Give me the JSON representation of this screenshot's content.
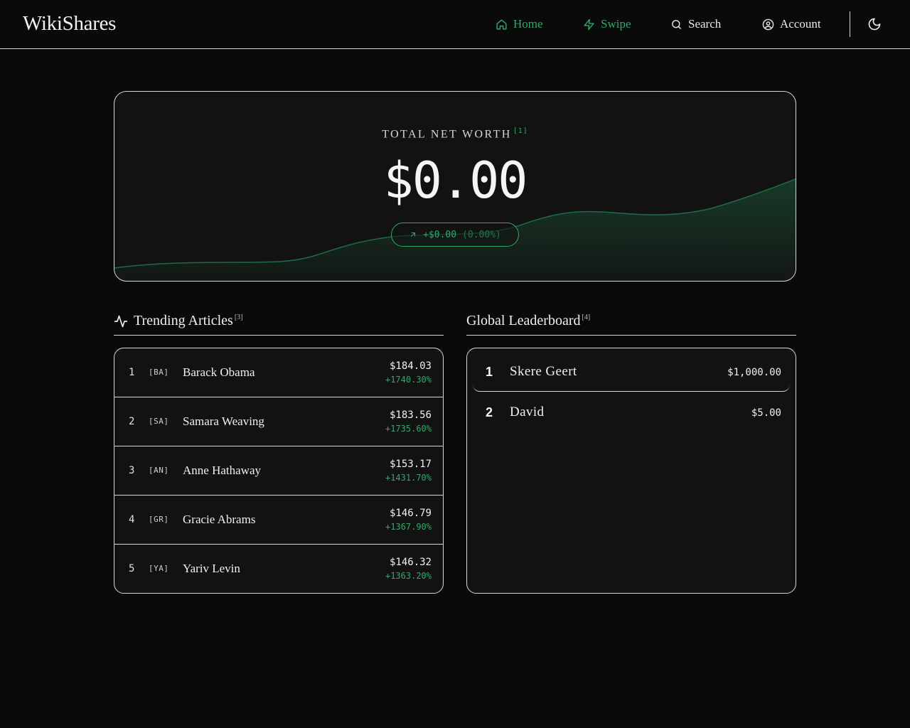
{
  "app": {
    "title": "WikiShares"
  },
  "nav": {
    "home": "Home",
    "swipe": "Swipe",
    "search": "Search",
    "account": "Account"
  },
  "colors": {
    "accent": "#2faa6a",
    "background": "#0a0a0a",
    "card": "#121212",
    "border": "#d8d8d8"
  },
  "icons": {
    "home": "home-icon",
    "swipe": "lightning-icon",
    "search": "search-icon",
    "account": "user-circle-icon",
    "theme": "moon-icon",
    "trending": "activity-icon",
    "change": "arrow-up-right-icon"
  },
  "hero": {
    "label": "TOTAL NET WORTH",
    "label_ref": "[1]",
    "value": "$0.00",
    "change": "+$0.00",
    "change_pct": "(0.00%)"
  },
  "trending": {
    "title": "Trending Articles",
    "ref": "[3]",
    "items": [
      {
        "rank": "1",
        "code": "[BA]",
        "name": "Barack Obama",
        "price": "$184.03",
        "change": "+1740.30%"
      },
      {
        "rank": "2",
        "code": "[SA]",
        "name": "Samara Weaving",
        "price": "$183.56",
        "change": "+1735.60%"
      },
      {
        "rank": "3",
        "code": "[AN]",
        "name": "Anne Hathaway",
        "price": "$153.17",
        "change": "+1431.70%"
      },
      {
        "rank": "4",
        "code": "[GR]",
        "name": "Gracie Abrams",
        "price": "$146.79",
        "change": "+1367.90%"
      },
      {
        "rank": "5",
        "code": "[YA]",
        "name": "Yariv Levin",
        "price": "$146.32",
        "change": "+1363.20%"
      }
    ]
  },
  "leaderboard": {
    "title": "Global Leaderboard",
    "ref": "[4]",
    "items": [
      {
        "rank": "1",
        "name": "Skere Geert",
        "value": "$1,000.00"
      },
      {
        "rank": "2",
        "name": "David",
        "value": "$5.00"
      }
    ]
  }
}
